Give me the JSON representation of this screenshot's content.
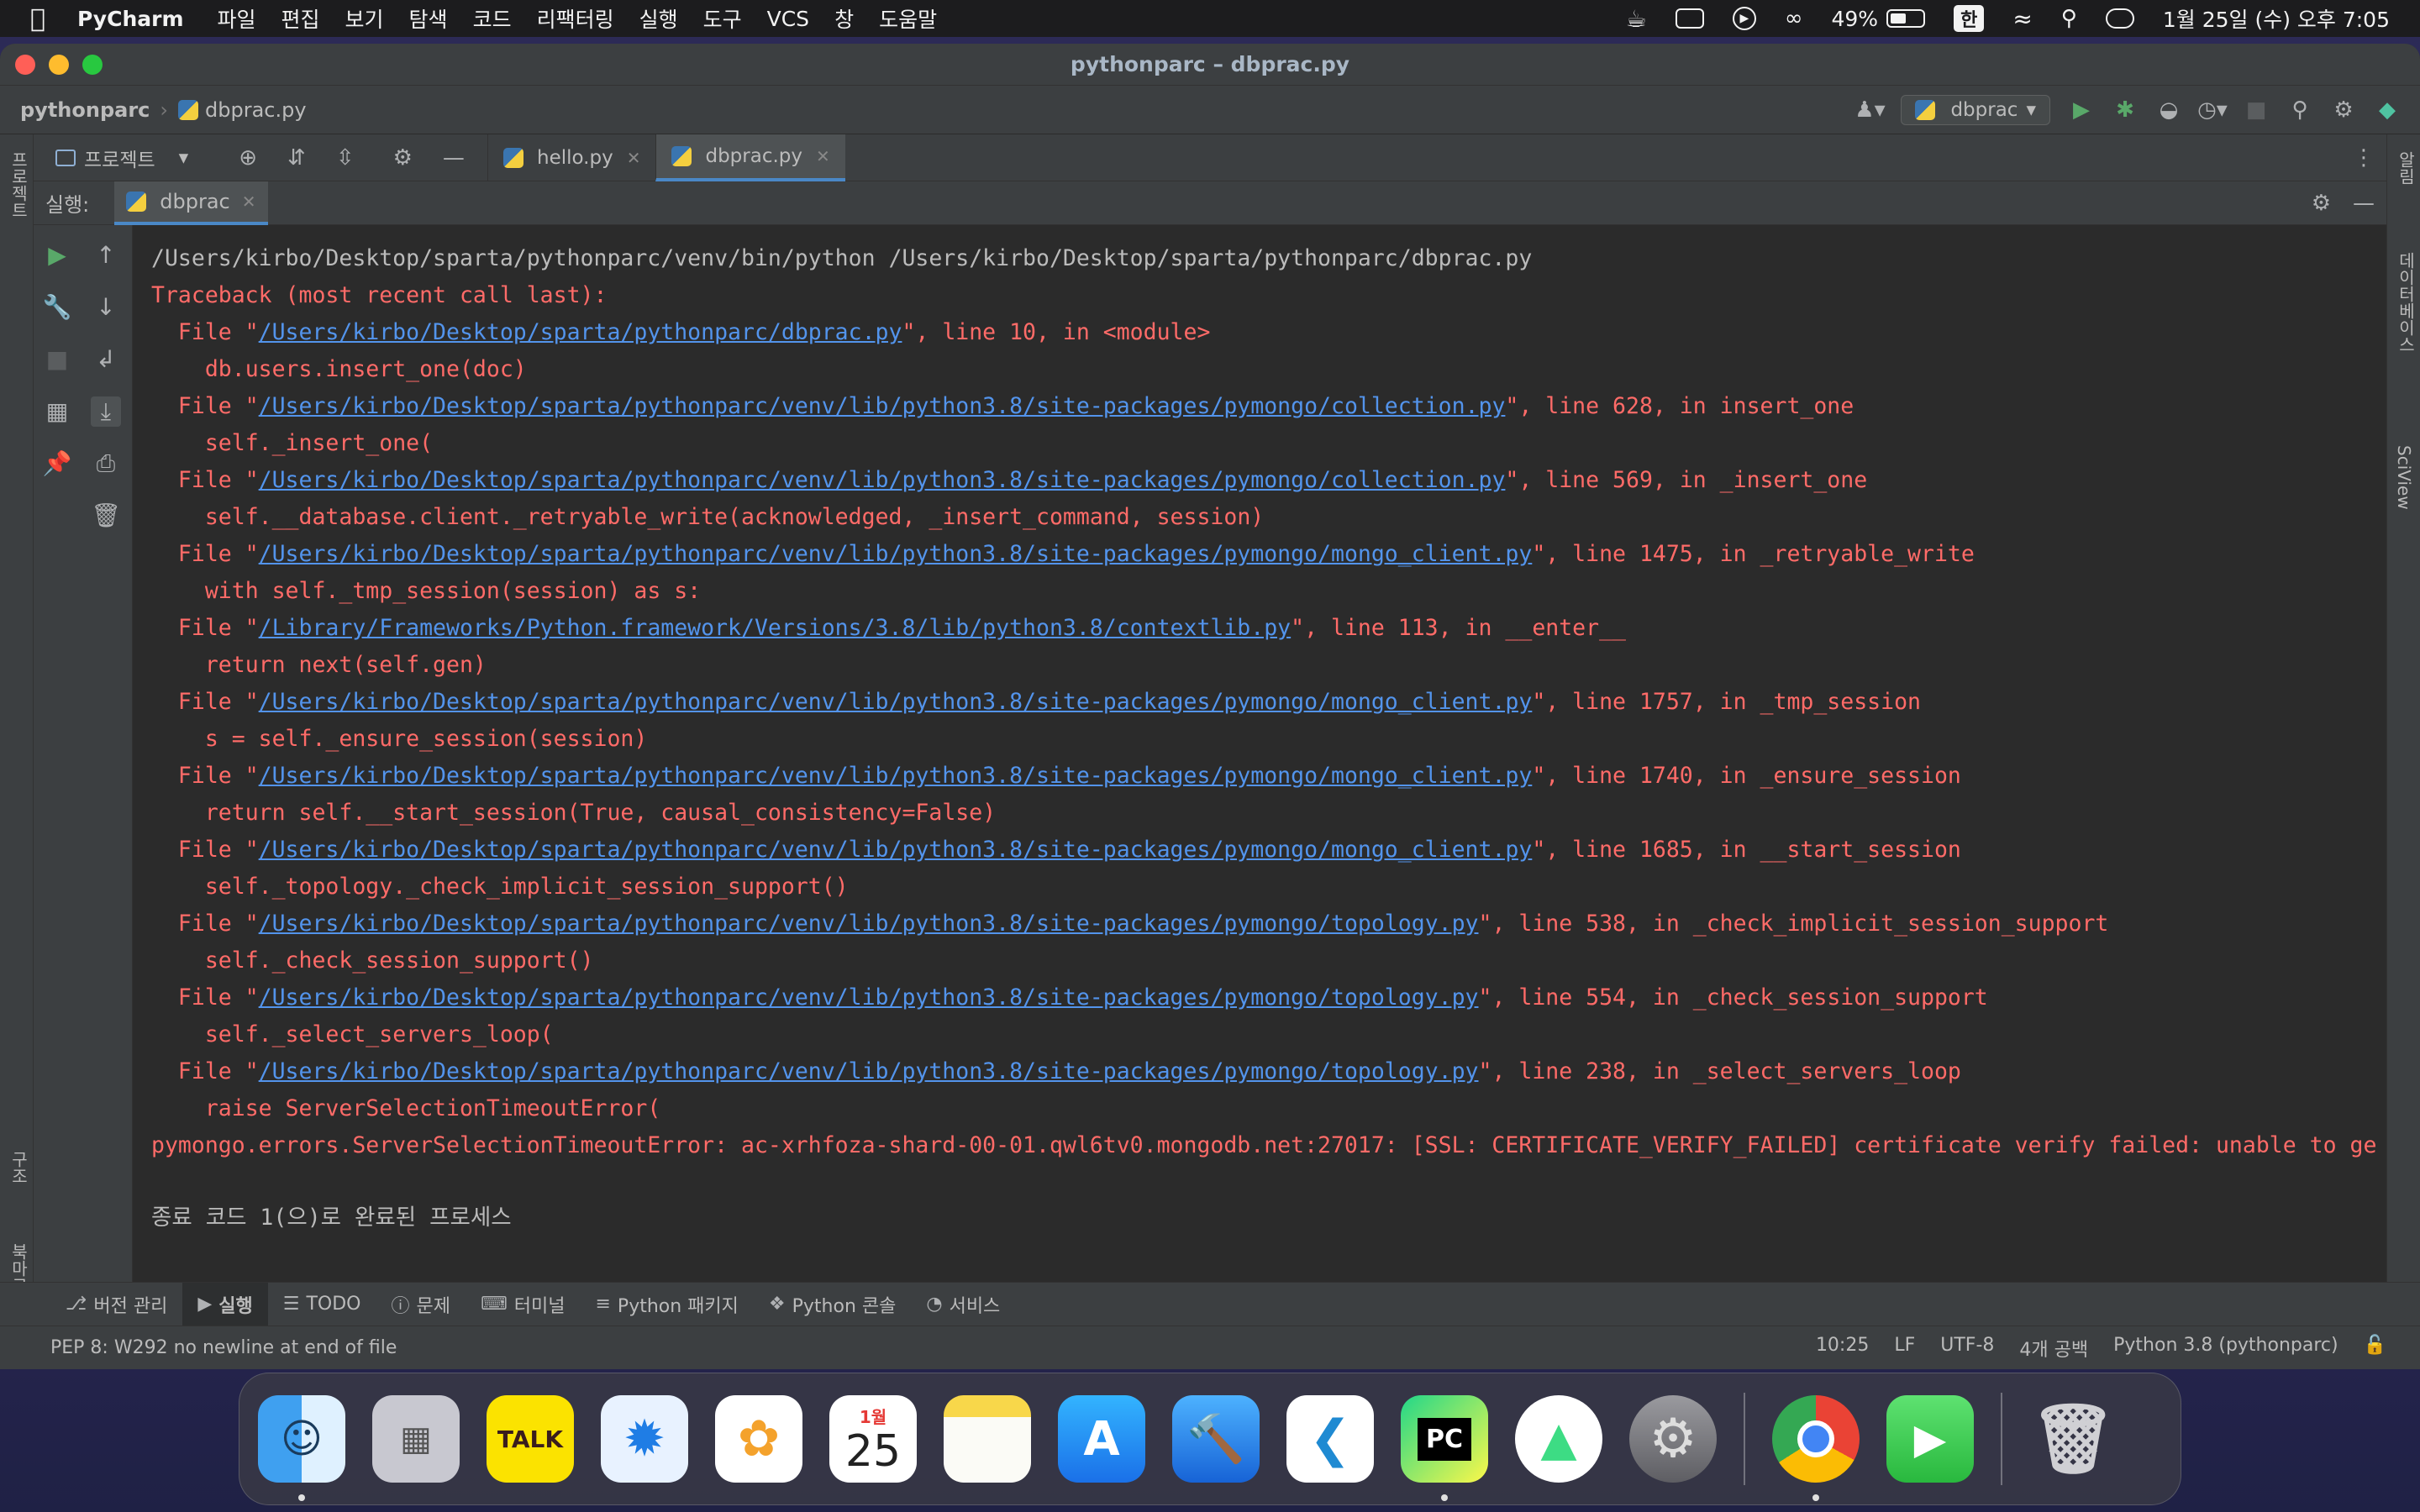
{
  "menubar": {
    "app_name": "PyCharm",
    "menus": [
      "파일",
      "편집",
      "보기",
      "탐색",
      "코드",
      "리팩터링",
      "실행",
      "도구",
      "VCS",
      "창",
      "도움말"
    ],
    "battery_percent": "49%",
    "battery_level": 0.49,
    "input_method": "한",
    "datetime": "1월 25일 (수) 오후 7:05"
  },
  "window": {
    "title": "pythonparc – dbprac.py"
  },
  "navbar": {
    "project": "pythonparc",
    "file": "dbprac.py",
    "run_config": "dbprac"
  },
  "sidebar": {
    "left_top_label": "프로젝트",
    "left_bottom_label_1": "구조",
    "left_bottom_label_2": "북마크",
    "right_label_1": "알림",
    "right_label_2": "데이터베이스",
    "right_label_3": "SciView"
  },
  "project_dropdown": {
    "label": "프로젝트"
  },
  "tabs": [
    {
      "label": "hello.py",
      "active": false
    },
    {
      "label": "dbprac.py",
      "active": true
    }
  ],
  "run_panel": {
    "label": "실행:",
    "tab": "dbprac"
  },
  "console": {
    "command": "/Users/kirbo/Desktop/sparta/pythonparc/venv/bin/python /Users/kirbo/Desktop/sparta/pythonparc/dbprac.py",
    "traceback_header": "Traceback (most recent call last):",
    "frames": [
      {
        "path": "/Users/kirbo/Desktop/sparta/pythonparc/dbprac.py",
        "tail": "\", line 10, in <module>",
        "code": "db.users.insert_one(doc)"
      },
      {
        "path": "/Users/kirbo/Desktop/sparta/pythonparc/venv/lib/python3.8/site-packages/pymongo/collection.py",
        "tail": "\", line 628, in insert_one",
        "code": "self._insert_one("
      },
      {
        "path": "/Users/kirbo/Desktop/sparta/pythonparc/venv/lib/python3.8/site-packages/pymongo/collection.py",
        "tail": "\", line 569, in _insert_one",
        "code": "self.__database.client._retryable_write(acknowledged, _insert_command, session)"
      },
      {
        "path": "/Users/kirbo/Desktop/sparta/pythonparc/venv/lib/python3.8/site-packages/pymongo/mongo_client.py",
        "tail": "\", line 1475, in _retryable_write",
        "code": "with self._tmp_session(session) as s:"
      },
      {
        "path": "/Library/Frameworks/Python.framework/Versions/3.8/lib/python3.8/contextlib.py",
        "tail": "\", line 113, in __enter__",
        "code": "return next(self.gen)"
      },
      {
        "path": "/Users/kirbo/Desktop/sparta/pythonparc/venv/lib/python3.8/site-packages/pymongo/mongo_client.py",
        "tail": "\", line 1757, in _tmp_session",
        "code": "s = self._ensure_session(session)"
      },
      {
        "path": "/Users/kirbo/Desktop/sparta/pythonparc/venv/lib/python3.8/site-packages/pymongo/mongo_client.py",
        "tail": "\", line 1740, in _ensure_session",
        "code": "return self.__start_session(True, causal_consistency=False)"
      },
      {
        "path": "/Users/kirbo/Desktop/sparta/pythonparc/venv/lib/python3.8/site-packages/pymongo/mongo_client.py",
        "tail": "\", line 1685, in __start_session",
        "code": "self._topology._check_implicit_session_support()"
      },
      {
        "path": "/Users/kirbo/Desktop/sparta/pythonparc/venv/lib/python3.8/site-packages/pymongo/topology.py",
        "tail": "\", line 538, in _check_implicit_session_support",
        "code": "self._check_session_support()"
      },
      {
        "path": "/Users/kirbo/Desktop/sparta/pythonparc/venv/lib/python3.8/site-packages/pymongo/topology.py",
        "tail": "\", line 554, in _check_session_support",
        "code": "self._select_servers_loop("
      },
      {
        "path": "/Users/kirbo/Desktop/sparta/pythonparc/venv/lib/python3.8/site-packages/pymongo/topology.py",
        "tail": "\", line 238, in _select_servers_loop",
        "code": "raise ServerSelectionTimeoutError("
      }
    ],
    "error_line": "pymongo.errors.ServerSelectionTimeoutError: ac-xrhfoza-shard-00-01.qwl6tv0.mongodb.net:27017: [SSL: CERTIFICATE_VERIFY_FAILED] certificate verify failed: unable to ge",
    "exit_message": "종료 코드 1(으)로 완료된 프로세스"
  },
  "bottom_tools": [
    {
      "label": "버전 관리",
      "icon": "branch-icon",
      "active": false
    },
    {
      "label": "실행",
      "icon": "play-icon",
      "active": true
    },
    {
      "label": "TODO",
      "icon": "list-icon",
      "active": false
    },
    {
      "label": "문제",
      "icon": "info-icon",
      "active": false
    },
    {
      "label": "터미널",
      "icon": "terminal-icon",
      "active": false
    },
    {
      "label": "Python 패키지",
      "icon": "layers-icon",
      "active": false
    },
    {
      "label": "Python 콘솔",
      "icon": "python-icon",
      "active": false
    },
    {
      "label": "서비스",
      "icon": "services-icon",
      "active": false
    }
  ],
  "statusbar": {
    "message": "PEP 8: W292 no newline at end of file",
    "position": "10:25",
    "line_sep": "LF",
    "encoding": "UTF-8",
    "indent": "4개 공백",
    "interpreter": "Python 3.8 (pythonparc)"
  },
  "dock": {
    "calendar_month": "1월",
    "calendar_day": "25",
    "kakaotalk_label": "TALK",
    "pycharm_label": "PC",
    "apps": [
      "finder",
      "launchpad",
      "kakaotalk",
      "safari",
      "photos",
      "calendar",
      "notes",
      "app-store",
      "xcode",
      "vscode",
      "pycharm",
      "android-studio",
      "system-settings",
      "chrome",
      "facetime",
      "trash"
    ]
  },
  "colors": {
    "error_red": "#ff6b68",
    "link_blue": "#5394ec",
    "accent": "#4a88c7",
    "run_green": "#59a869"
  }
}
